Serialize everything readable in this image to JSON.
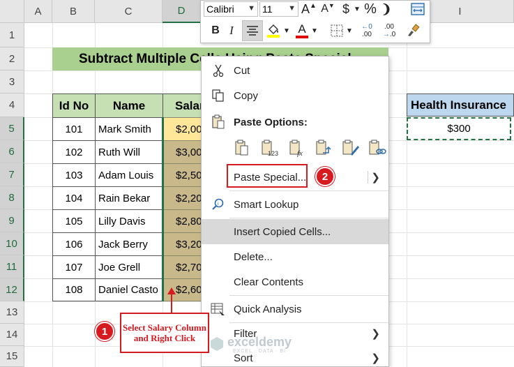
{
  "columns": [
    "A",
    "B",
    "C",
    "D",
    "I"
  ],
  "rows": [
    "1",
    "2",
    "3",
    "4",
    "5",
    "6",
    "7",
    "8",
    "9",
    "10",
    "11",
    "12",
    "13",
    "14",
    "15"
  ],
  "title": "Subtract Multiple Cells Using Paste Special",
  "table": {
    "headers": {
      "id": "Id No",
      "name": "Name",
      "salary": "Salar"
    },
    "rows": [
      {
        "id": "101",
        "name": "Mark Smith",
        "salary": "$2,00"
      },
      {
        "id": "102",
        "name": "Ruth Will",
        "salary": "$3,00"
      },
      {
        "id": "103",
        "name": "Adam Louis",
        "salary": "$2,50"
      },
      {
        "id": "104",
        "name": "Rain Bekar",
        "salary": "$2,20"
      },
      {
        "id": "105",
        "name": "Lilly Davis",
        "salary": "$2,80"
      },
      {
        "id": "106",
        "name": "Jack Berry",
        "salary": "$3,20"
      },
      {
        "id": "107",
        "name": "Joe Grell",
        "salary": "$2,70"
      },
      {
        "id": "108",
        "name": "Daniel Casto",
        "salary": "$2,60"
      }
    ]
  },
  "health_insurance": {
    "header": "Health Insurance",
    "value": "$300"
  },
  "mini_toolbar": {
    "font": "Calibri",
    "size": "11",
    "grow_label": "A",
    "shrink_label": "A",
    "dollar_label": "$",
    "percent_label": "%",
    "comma_label": "❩",
    "bold_label": "B",
    "italic_label": "I",
    "font_color_label": "A",
    "inc_decimal_label": ".00",
    "dec_decimal_label": ".0"
  },
  "context_menu": {
    "cut": "Cut",
    "copy": "Copy",
    "paste_options": "Paste Options:",
    "paste_special": "Paste Special...",
    "smart_lookup": "Smart Lookup",
    "insert_copied_cells": "Insert Copied Cells...",
    "delete": "Delete...",
    "clear_contents": "Clear Contents",
    "quick_analysis": "Quick Analysis",
    "filter": "Filter",
    "sort": "Sort"
  },
  "annotations": {
    "step1": "1",
    "step2": "2",
    "callout": "Select Salary Column and Right Click"
  },
  "watermark": {
    "name": "exceldemy",
    "tagline": "EXCEL · DATA · BI"
  },
  "colors": {
    "accent_green": "#217346",
    "title_band": "#a9d08e",
    "table_header": "#c6e0b4",
    "highlight_red": "#d71920"
  }
}
